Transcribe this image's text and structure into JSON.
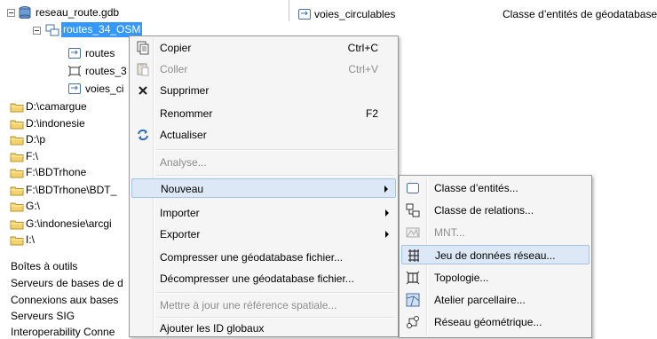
{
  "tree": {
    "gdb_label": "reseau_route.gdb",
    "dataset_label": "routes_34_OSM",
    "children": [
      {
        "label": "routes"
      },
      {
        "label": "routes_3"
      },
      {
        "label": "voies_ci"
      }
    ],
    "folders": [
      {
        "label": "D:\\camargue"
      },
      {
        "label": "D:\\indonesie"
      },
      {
        "label": "D:\\p"
      },
      {
        "label": "F:\\"
      },
      {
        "label": "F:\\BDTrhone"
      },
      {
        "label": "F:\\BDTrhone\\BDT_"
      },
      {
        "label": "G:\\"
      },
      {
        "label": "G:\\indonesie\\arcgi"
      },
      {
        "label": "I:\\"
      }
    ],
    "roots": [
      {
        "label": "Boîtes à outils"
      },
      {
        "label": "Serveurs de bases de d"
      },
      {
        "label": "Connexions aux bases"
      },
      {
        "label": "Serveurs SIG"
      },
      {
        "label": "Interoperability Conne"
      }
    ]
  },
  "contents": {
    "name": "voies_circulables",
    "type": "Classe d’entités de géodatabase"
  },
  "context_menu": {
    "items": [
      {
        "label": "Copier",
        "shortcut": "Ctrl+C",
        "icon": "copy-icon"
      },
      {
        "label": "Coller",
        "shortcut": "Ctrl+V",
        "icon": "paste-icon"
      },
      {
        "label": "Supprimer",
        "shortcut": "",
        "icon": "delete-icon"
      },
      {
        "label": "Renommer",
        "shortcut": "F2",
        "icon": ""
      },
      {
        "label": "Actualiser",
        "shortcut": "",
        "icon": "refresh-icon"
      },
      {
        "label": "Analyse...",
        "shortcut": "",
        "icon": ""
      },
      {
        "label": "Nouveau",
        "shortcut": "",
        "icon": ""
      },
      {
        "label": "Importer",
        "shortcut": "",
        "icon": ""
      },
      {
        "label": "Exporter",
        "shortcut": "",
        "icon": ""
      },
      {
        "label": "Compresser une géodatabase fichier...",
        "shortcut": "",
        "icon": ""
      },
      {
        "label": "Décompresser une géodatabase fichier...",
        "shortcut": "",
        "icon": ""
      },
      {
        "label": "Mettre à jour une référence spatiale...",
        "shortcut": "",
        "icon": ""
      },
      {
        "label": "Ajouter les ID globaux",
        "shortcut": "",
        "icon": ""
      }
    ]
  },
  "submenu": {
    "items": [
      {
        "label": "Classe d’entités...",
        "icon": "feature-class-icon"
      },
      {
        "label": "Classe de relations...",
        "icon": "relationship-class-icon"
      },
      {
        "label": "MNT...",
        "icon": "terrain-icon"
      },
      {
        "label": "Jeu de données réseau...",
        "icon": "network-dataset-icon"
      },
      {
        "label": "Topologie...",
        "icon": "topology-icon"
      },
      {
        "label": "Atelier parcellaire...",
        "icon": "parcel-fabric-icon"
      },
      {
        "label": "Réseau géométrique...",
        "icon": "geometric-network-icon"
      }
    ]
  },
  "colors": {
    "selection_blue": "#3399ff",
    "highlight": "#dce8f5",
    "folder_yellow": "#f2d36b"
  }
}
